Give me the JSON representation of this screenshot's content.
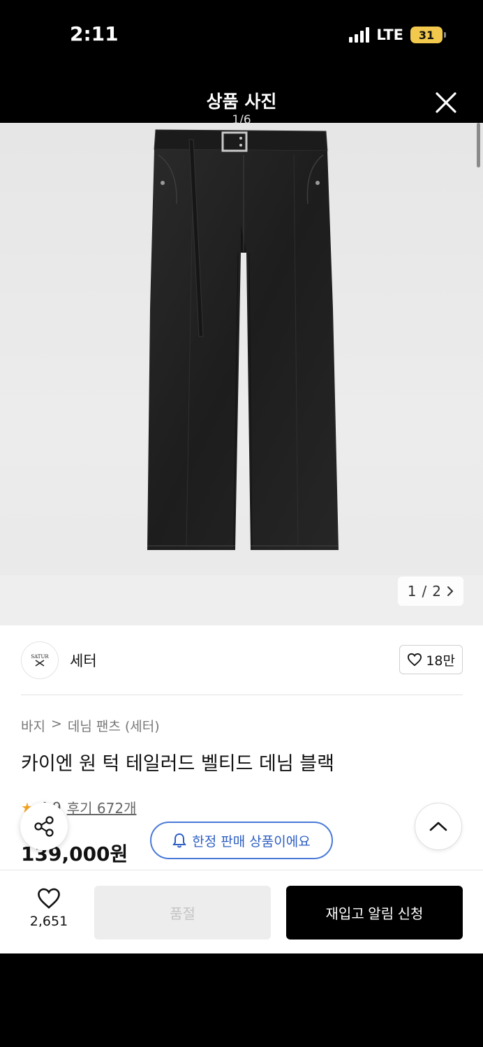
{
  "status_bar": {
    "time": "2:11",
    "network": "LTE",
    "battery": "31"
  },
  "photo_viewer": {
    "title": "상품 사진",
    "counter": "1/6"
  },
  "image": {
    "pager_current": "1",
    "pager_separator": "/",
    "pager_total": "2"
  },
  "brand": {
    "logo_text_top": "SATUR",
    "name": "세터",
    "likes": "18만"
  },
  "breadcrumb": {
    "category": "바지",
    "separator": ">",
    "subcategory": "데님 팬츠 (세터)"
  },
  "product": {
    "title": "카이엔 원 턱 테일러드 벨티드 데님 블랙",
    "rating": "4.9",
    "reviews": "후기 672개",
    "price": "139,000원",
    "limited_label": "한정 판매 상품이에요"
  },
  "bottom_bar": {
    "wish_count": "2,651",
    "soldout_label": "품절",
    "restock_label": "재입고 알림 신청"
  },
  "colors": {
    "accent_blue": "#2c5dc2",
    "star": "#f5a623",
    "primary_button": "#000000"
  },
  "icons": {
    "close": "close-icon",
    "share": "share-icon",
    "heart": "heart-icon",
    "chevron_up": "chevron-up-icon",
    "bell": "bell-icon",
    "chevron_right": "chevron-right-icon"
  }
}
